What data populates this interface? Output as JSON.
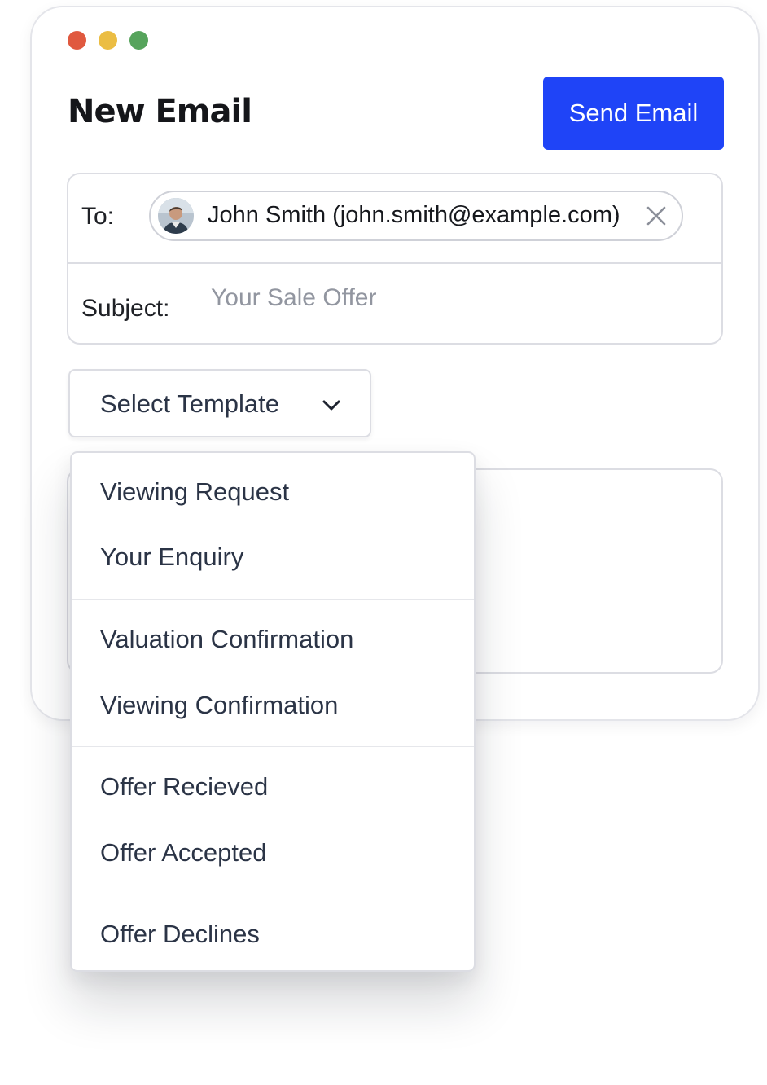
{
  "window": {
    "controls": {
      "close_color": "#e0593f",
      "minimize_color": "#ebbd43",
      "maximize_color": "#56a45c"
    },
    "title": "New Email",
    "send_button": {
      "label": "Send Email",
      "color": "#1f44f7"
    }
  },
  "compose": {
    "to_label": "To:",
    "recipient": {
      "display": "John Smith (john.smith@example.com)",
      "avatar_icon": "user-avatar",
      "remove_icon": "close-icon"
    },
    "subject_label": "Subject:",
    "subject_placeholder": "Your Sale Offer",
    "subject_value": ""
  },
  "template_select": {
    "label": "Select Template",
    "icon": "chevron-down-icon",
    "open": true,
    "groups": [
      [
        "Viewing Request",
        "Your Enquiry"
      ],
      [
        "Valuation Confirmation",
        "Viewing Confirmation"
      ],
      [
        "Offer Recieved",
        "Offer Accepted"
      ],
      [
        "Offer Declines"
      ]
    ]
  }
}
